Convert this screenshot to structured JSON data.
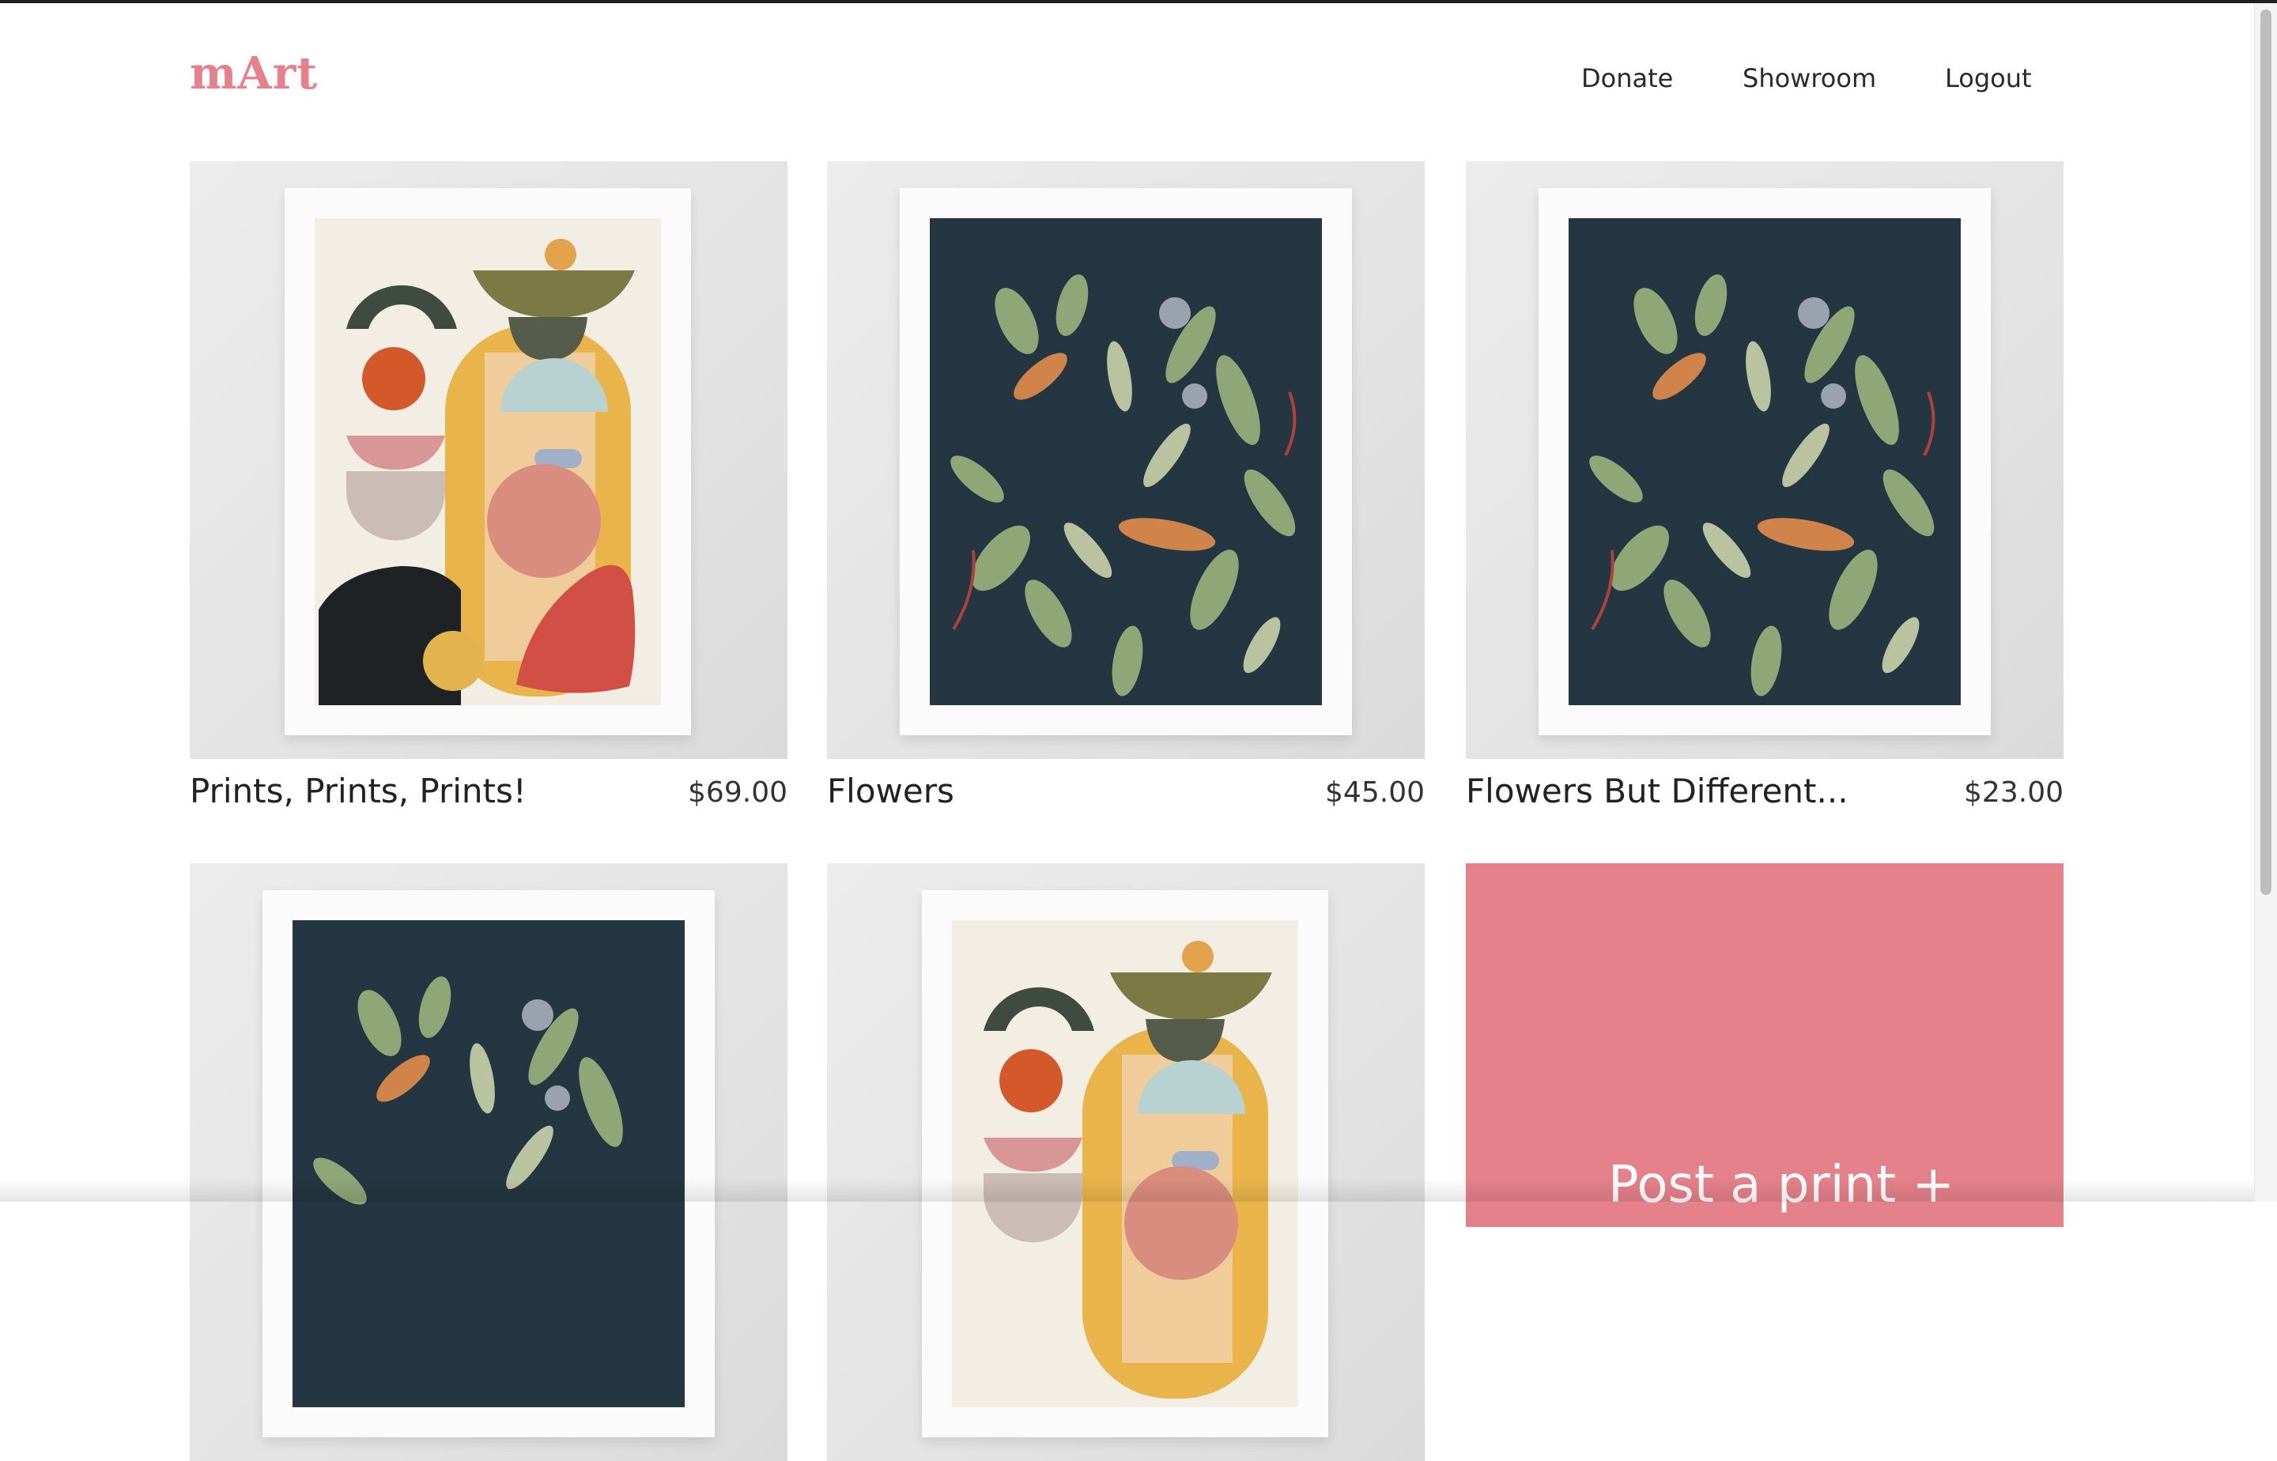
{
  "brand": {
    "name": "mArt",
    "color": "#e5818a"
  },
  "nav": {
    "donate": "Donate",
    "showroom": "Showroom",
    "logout": "Logout"
  },
  "products": [
    {
      "title": "Prints, Prints, Prints!",
      "price": "$69.00",
      "artwork": "abstract-shapes"
    },
    {
      "title": "Flowers",
      "price": "$45.00",
      "artwork": "jungle-cheetah"
    },
    {
      "title": "Flowers But Different...",
      "price": "$23.00",
      "artwork": "jungle-cheetah"
    },
    {
      "title": "",
      "price": "",
      "artwork": "jungle-cheetah"
    },
    {
      "title": "",
      "price": "",
      "artwork": "abstract-shapes"
    }
  ],
  "cta": {
    "label": "Post a print +",
    "color": "#e5818a"
  }
}
